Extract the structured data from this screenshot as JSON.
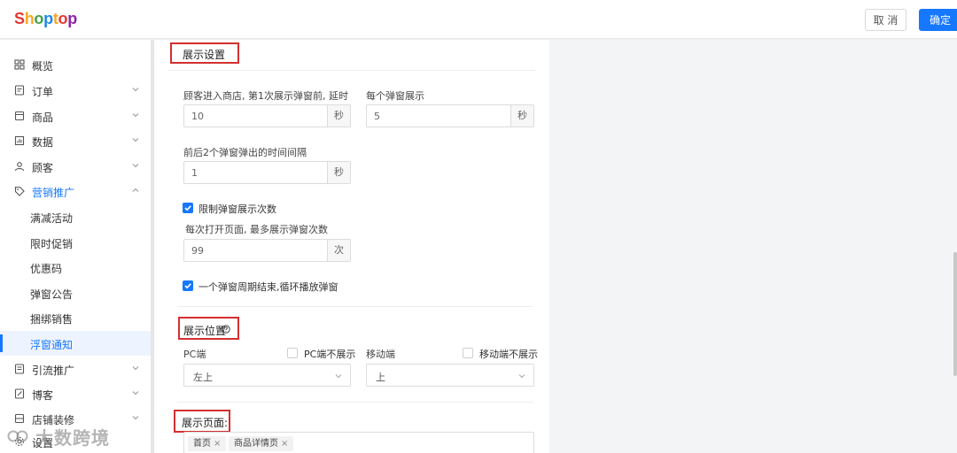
{
  "header": {
    "logo": [
      "S",
      "h",
      "o",
      "p",
      "t",
      "o",
      "p"
    ],
    "cancel_label": "取 消",
    "ok_label": "确定"
  },
  "sidebar": {
    "items": [
      {
        "label": "概览",
        "icon": "dashboard-icon"
      },
      {
        "label": "订单",
        "icon": "order-icon"
      },
      {
        "label": "商品",
        "icon": "product-icon"
      },
      {
        "label": "数据",
        "icon": "chart-icon"
      },
      {
        "label": "顾客",
        "icon": "user-icon"
      },
      {
        "label": "营销推广",
        "icon": "tag-icon"
      },
      {
        "label": "满减活动"
      },
      {
        "label": "限时促销"
      },
      {
        "label": "优惠码"
      },
      {
        "label": "弹窗公告"
      },
      {
        "label": "捆绑销售"
      },
      {
        "label": "浮窗通知"
      },
      {
        "label": "引流推广",
        "icon": "traffic-icon"
      },
      {
        "label": "博客",
        "icon": "blog-icon"
      },
      {
        "label": "店铺装修",
        "icon": "store-icon"
      },
      {
        "label": "设置",
        "icon": "gear-icon"
      }
    ]
  },
  "display_settings": {
    "title": "展示设置",
    "delay_label": "顾客进入商店, 第1次展示弹窗前, 延时",
    "delay_value": "10",
    "delay_unit": "秒",
    "each_label": "每个弹窗展示",
    "each_value": "5",
    "each_unit": "秒",
    "interval_label": "前后2个弹窗弹出的时间间隔",
    "interval_value": "1",
    "interval_unit": "秒",
    "limit_checkbox_label": "限制弹窗展示次数",
    "max_label": "每次打开页面, 最多展示弹窗次数",
    "max_value": "99",
    "max_unit": "次",
    "loop_checkbox_label": "一个弹窗周期结束,循环播放弹窗"
  },
  "position": {
    "title": "展示位置",
    "pc_label": "PC端",
    "pc_hide_label": "PC端不展示",
    "pc_value": "左上",
    "mobile_label": "移动端",
    "mobile_hide_label": "移动端不展示",
    "mobile_value": "上"
  },
  "pages": {
    "title": "展示页面:",
    "tags": [
      "首页",
      "商品详情页"
    ],
    "tag_remove": "×"
  },
  "watermark": {
    "text": "大数跨境"
  },
  "colors": {
    "accent": "#1677ff",
    "highlight": "#d32f2f"
  }
}
